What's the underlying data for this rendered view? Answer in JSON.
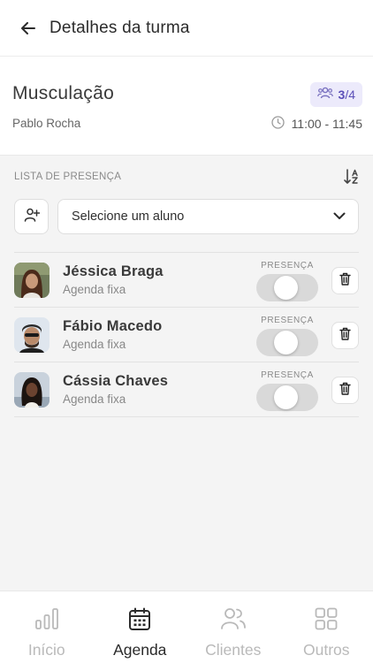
{
  "header": {
    "title": "Detalhes da turma",
    "back_icon": "arrow-left-icon"
  },
  "class_info": {
    "name": "Musculação",
    "teacher": "Pablo Rocha",
    "capacity": {
      "current": "3",
      "separator": "/",
      "max": "4"
    },
    "time": "11:00 - 11:45"
  },
  "attendance": {
    "title": "LISTA DE PRESENÇA",
    "select_placeholder": "Selecione um aluno",
    "presence_label": "PRESENÇA",
    "students": [
      {
        "name": "Jéssica Braga",
        "schedule": "Agenda fixa",
        "present": false
      },
      {
        "name": "Fábio Macedo",
        "schedule": "Agenda fixa",
        "present": false
      },
      {
        "name": "Cássia Chaves",
        "schedule": "Agenda fixa",
        "present": false
      }
    ]
  },
  "bottom_nav": {
    "items": [
      {
        "label": "Início",
        "icon": "bar-chart-icon",
        "active": false
      },
      {
        "label": "Agenda",
        "icon": "calendar-icon",
        "active": true
      },
      {
        "label": "Clientes",
        "icon": "users-icon",
        "active": false
      },
      {
        "label": "Outros",
        "icon": "grid-icon",
        "active": false
      }
    ]
  },
  "colors": {
    "accent": "#5b4fb8",
    "badge_bg": "#eceafb",
    "inactive": "#b9b9b9",
    "toggle_off": "#d9d9d9"
  }
}
